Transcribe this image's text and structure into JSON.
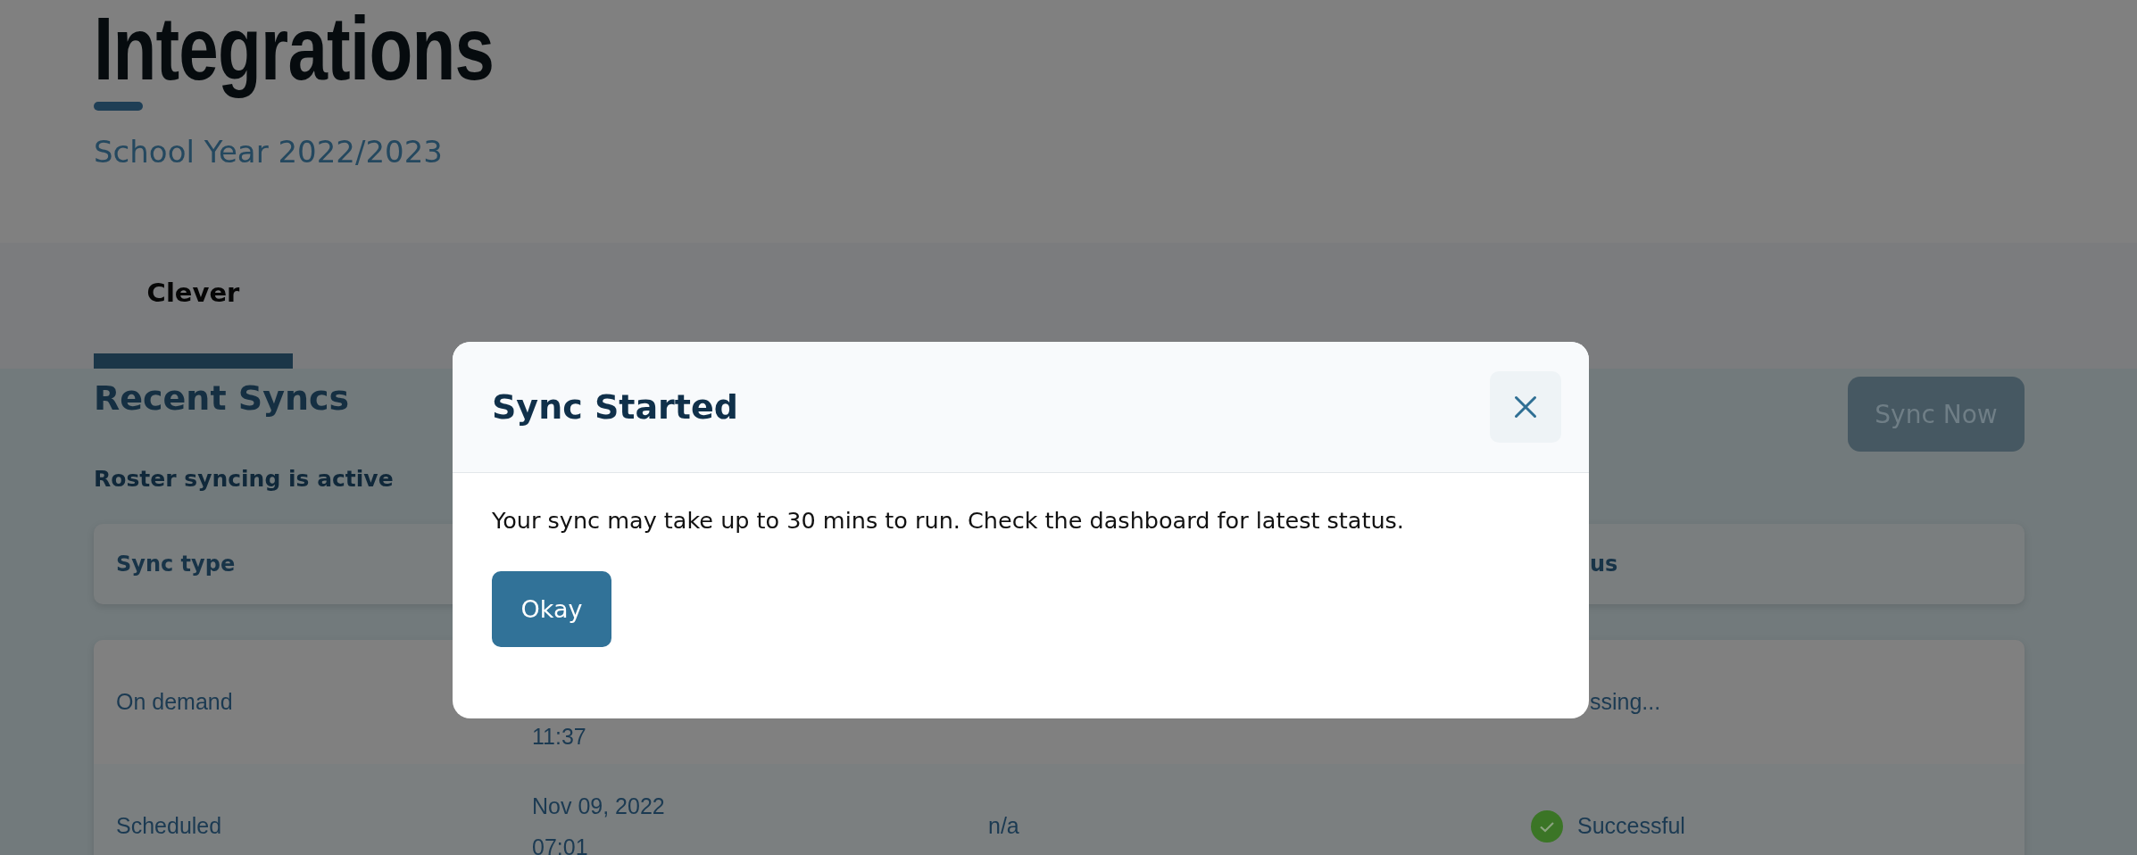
{
  "page": {
    "title": "Integrations",
    "subtitle": "School Year 2022/2023"
  },
  "tabs": [
    {
      "label": "Clever",
      "selected": true
    }
  ],
  "section": {
    "title": "Recent Syncs",
    "sync_button": {
      "label": "Sync Now",
      "disabled": true
    },
    "note": "Roster syncing is active"
  },
  "table": {
    "header": {
      "sync_type": "Sync type",
      "status": "us"
    },
    "rows": [
      {
        "sync_type": "On demand",
        "started": [
          "11:37"
        ],
        "status": "ssing...",
        "kind": "processing"
      },
      {
        "sync_type": "Scheduled",
        "started": [
          "Nov 09, 2022",
          "07:01"
        ],
        "column_3": "n/a",
        "status": "Successful",
        "kind": "success"
      }
    ]
  },
  "dialog": {
    "title": "Sync Started",
    "message": "Your sync may take up to 30 mins to run. Check the dashboard for latest status.",
    "button": "Okay"
  }
}
